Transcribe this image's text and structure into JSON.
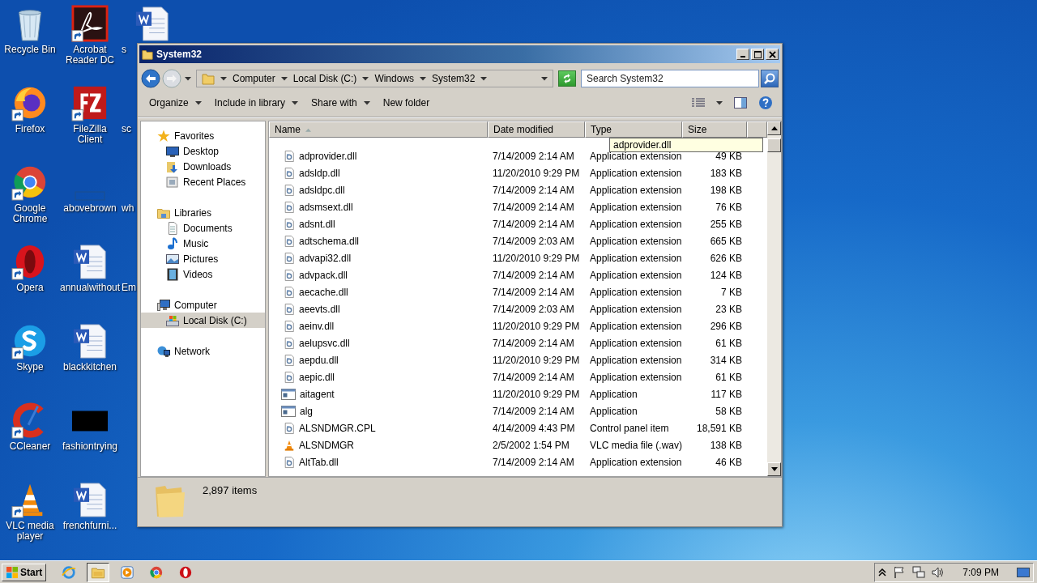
{
  "desktop": {
    "icons": [
      {
        "label": "Recycle Bin",
        "kind": "recycle-bin",
        "shortcut": false
      },
      {
        "label": "Firefox",
        "kind": "firefox",
        "shortcut": true
      },
      {
        "label": "Google Chrome",
        "kind": "chrome",
        "shortcut": true
      },
      {
        "label": "Opera",
        "kind": "opera",
        "shortcut": true
      },
      {
        "label": "Skype",
        "kind": "skype",
        "shortcut": true
      },
      {
        "label": "CCleaner",
        "kind": "ccleaner",
        "shortcut": true
      },
      {
        "label": "VLC media player",
        "kind": "vlc",
        "shortcut": true
      },
      {
        "label": "Acrobat Reader DC",
        "kind": "acrobat",
        "shortcut": true
      },
      {
        "label": "FileZilla Client",
        "kind": "filezilla",
        "shortcut": true
      },
      {
        "label": "abovebrown",
        "kind": "blank",
        "shortcut": false
      },
      {
        "label": "annualwithout",
        "kind": "word",
        "shortcut": false
      },
      {
        "label": "blackkitchen",
        "kind": "word",
        "shortcut": false
      },
      {
        "label": "fashiontrying",
        "kind": "black",
        "shortcut": false
      },
      {
        "label": "frenchfurni...",
        "kind": "word",
        "shortcut": false
      }
    ],
    "partial_column": [
      {
        "label": "s",
        "kind": "word"
      },
      {
        "label": "sc"
      },
      {
        "label": "wh"
      },
      {
        "label": "Em"
      }
    ]
  },
  "window": {
    "title": "System32",
    "address": {
      "crumbs": [
        "Computer",
        "Local Disk (C:)",
        "Windows",
        "System32"
      ]
    },
    "search": {
      "placeholder": "Search System32"
    },
    "commands": [
      {
        "label": "Organize",
        "dropdown": true
      },
      {
        "label": "Include in library",
        "dropdown": true
      },
      {
        "label": "Share with",
        "dropdown": true
      },
      {
        "label": "New folder",
        "dropdown": false
      }
    ],
    "nav": [
      {
        "label": "Favorites",
        "kind": "star",
        "selected": false,
        "children": [
          {
            "label": "Desktop",
            "kind": "desktop",
            "selected": false
          },
          {
            "label": "Downloads",
            "kind": "downloads",
            "selected": false
          },
          {
            "label": "Recent Places",
            "kind": "recent",
            "selected": false
          }
        ]
      },
      {
        "label": "Libraries",
        "kind": "libraries",
        "selected": false,
        "children": [
          {
            "label": "Documents",
            "kind": "documents",
            "selected": false
          },
          {
            "label": "Music",
            "kind": "music",
            "selected": false
          },
          {
            "label": "Pictures",
            "kind": "pictures",
            "selected": false
          },
          {
            "label": "Videos",
            "kind": "videos",
            "selected": false
          }
        ]
      },
      {
        "label": "Computer",
        "kind": "computer",
        "selected": false,
        "children": [
          {
            "label": "Local Disk (C:)",
            "kind": "disk",
            "selected": true
          }
        ]
      },
      {
        "label": "Network",
        "kind": "network",
        "selected": false
      }
    ],
    "columns": [
      {
        "label": "Name",
        "sorted": true
      },
      {
        "label": "Date modified",
        "sorted": false
      },
      {
        "label": "Type",
        "sorted": false
      },
      {
        "label": "Size",
        "sorted": false
      }
    ],
    "rows": [
      {
        "name": "adprovider.dll",
        "kind": "dll",
        "date": "7/14/2009 2:14 AM",
        "type": "Application extension",
        "size": "49 KB"
      },
      {
        "name": "adsldp.dll",
        "kind": "dll",
        "date": "11/20/2010 9:29 PM",
        "type": "Application extension",
        "size": "183 KB"
      },
      {
        "name": "adsldpc.dll",
        "kind": "dll",
        "date": "7/14/2009 2:14 AM",
        "type": "Application extension",
        "size": "198 KB"
      },
      {
        "name": "adsmsext.dll",
        "kind": "dll",
        "date": "7/14/2009 2:14 AM",
        "type": "Application extension",
        "size": "76 KB"
      },
      {
        "name": "adsnt.dll",
        "kind": "dll",
        "date": "7/14/2009 2:14 AM",
        "type": "Application extension",
        "size": "255 KB"
      },
      {
        "name": "adtschema.dll",
        "kind": "dll",
        "date": "7/14/2009 2:03 AM",
        "type": "Application extension",
        "size": "665 KB"
      },
      {
        "name": "advapi32.dll",
        "kind": "dll",
        "date": "11/20/2010 9:29 PM",
        "type": "Application extension",
        "size": "626 KB"
      },
      {
        "name": "advpack.dll",
        "kind": "dll",
        "date": "7/14/2009 2:14 AM",
        "type": "Application extension",
        "size": "124 KB"
      },
      {
        "name": "aecache.dll",
        "kind": "dll",
        "date": "7/14/2009 2:14 AM",
        "type": "Application extension",
        "size": "7 KB"
      },
      {
        "name": "aeevts.dll",
        "kind": "dll",
        "date": "7/14/2009 2:03 AM",
        "type": "Application extension",
        "size": "23 KB"
      },
      {
        "name": "aeinv.dll",
        "kind": "dll",
        "date": "11/20/2010 9:29 PM",
        "type": "Application extension",
        "size": "296 KB"
      },
      {
        "name": "aelupsvc.dll",
        "kind": "dll",
        "date": "7/14/2009 2:14 AM",
        "type": "Application extension",
        "size": "61 KB"
      },
      {
        "name": "aepdu.dll",
        "kind": "dll",
        "date": "11/20/2010 9:29 PM",
        "type": "Application extension",
        "size": "314 KB"
      },
      {
        "name": "aepic.dll",
        "kind": "dll",
        "date": "7/14/2009 2:14 AM",
        "type": "Application extension",
        "size": "61 KB"
      },
      {
        "name": "aitagent",
        "kind": "app",
        "date": "11/20/2010 9:29 PM",
        "type": "Application",
        "size": "117 KB"
      },
      {
        "name": "alg",
        "kind": "app",
        "date": "7/14/2009 2:14 AM",
        "type": "Application",
        "size": "58 KB"
      },
      {
        "name": "ALSNDMGR.CPL",
        "kind": "dll",
        "date": "4/14/2009 4:43 PM",
        "type": "Control panel item",
        "size": "18,591 KB"
      },
      {
        "name": "ALSNDMGR",
        "kind": "vlc",
        "date": "2/5/2002 1:54 PM",
        "type": "VLC media file (.wav)",
        "size": "138 KB"
      },
      {
        "name": "AltTab.dll",
        "kind": "dll",
        "date": "7/14/2009 2:14 AM",
        "type": "Application extension",
        "size": "46 KB"
      }
    ],
    "tooltip": "adprovider.dll",
    "status": "2,897 items"
  },
  "taskbar": {
    "start": "Start",
    "pinned": [
      {
        "kind": "ie",
        "active": false
      },
      {
        "kind": "explorer",
        "active": true
      },
      {
        "kind": "media",
        "active": false
      },
      {
        "kind": "chrome",
        "active": false
      },
      {
        "kind": "opera",
        "active": false
      }
    ],
    "clock": "7:09 PM"
  }
}
